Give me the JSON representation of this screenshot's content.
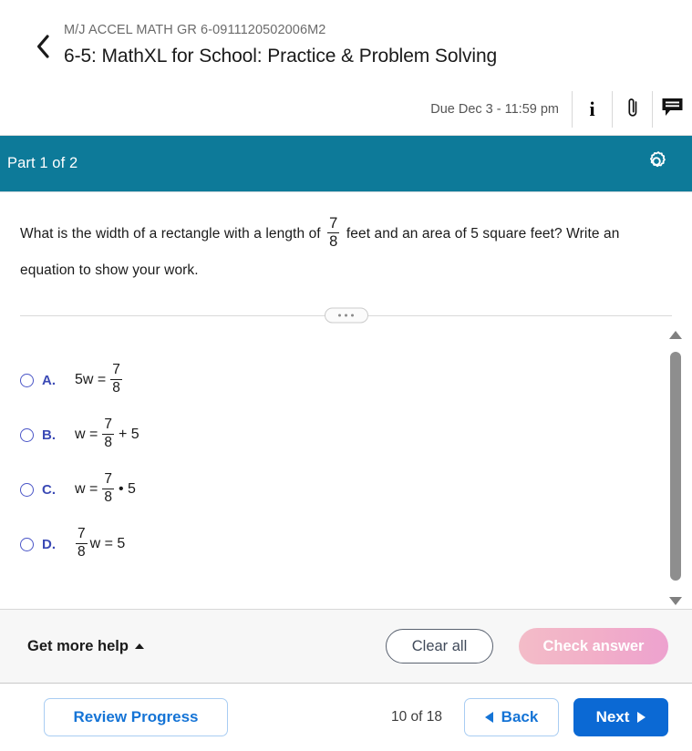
{
  "header": {
    "course_code": "M/J ACCEL MATH GR 6-0911120502006M2",
    "assignment_title": "6-5: MathXL for School: Practice & Problem Solving",
    "due_text": "Due Dec 3 - 11:59 pm",
    "back_icon": "chevron-left-icon",
    "icons": [
      {
        "name": "info-icon",
        "glyph": "i"
      },
      {
        "name": "paperclip-icon",
        "glyph": "paperclip"
      },
      {
        "name": "message-icon",
        "glyph": "speech-bubble"
      }
    ]
  },
  "part_bar": {
    "label": "Part 1 of 2",
    "settings_icon": "gear-icon",
    "background_color": "#0d7a99"
  },
  "question": {
    "text_before": "What is the width of a rectangle with a length of",
    "fraction": {
      "numerator": "7",
      "denominator": "8"
    },
    "text_after": "feet and an area of 5 square feet? Write an equation to show your work."
  },
  "divider": {
    "handle_icon": "drag-handle-dots-icon"
  },
  "options": [
    {
      "letter": "A.",
      "selected": false,
      "parts": [
        {
          "type": "text",
          "value": "5w ="
        },
        {
          "type": "fraction",
          "numerator": "7",
          "denominator": "8"
        }
      ],
      "plain": "5w = 7/8"
    },
    {
      "letter": "B.",
      "selected": false,
      "parts": [
        {
          "type": "text",
          "value": "w ="
        },
        {
          "type": "fraction",
          "numerator": "7",
          "denominator": "8"
        },
        {
          "type": "text",
          "value": "+ 5"
        }
      ],
      "plain": "w = 7/8 + 5"
    },
    {
      "letter": "C.",
      "selected": false,
      "parts": [
        {
          "type": "text",
          "value": "w ="
        },
        {
          "type": "fraction",
          "numerator": "7",
          "denominator": "8"
        },
        {
          "type": "text",
          "value": "• 5"
        }
      ],
      "plain": "w = 7/8 • 5"
    },
    {
      "letter": "D.",
      "selected": false,
      "parts": [
        {
          "type": "fraction",
          "numerator": "7",
          "denominator": "8"
        },
        {
          "type": "text",
          "value": "w = 5"
        }
      ],
      "plain": "7/8 w = 5"
    }
  ],
  "scrollbar": {
    "up_icon": "scroll-up-arrow-icon",
    "down_icon": "scroll-down-arrow-icon"
  },
  "action_bar": {
    "get_more_help_label": "Get more help",
    "get_more_help_caret": "caret-up-icon",
    "clear_all_label": "Clear all",
    "check_answer_label": "Check answer",
    "check_answer_disabled": true,
    "check_answer_color": "#f0b0c8"
  },
  "bottom_nav": {
    "review_progress_label": "Review Progress",
    "page_indicator": "10 of 18",
    "back_label": "Back",
    "next_label": "Next",
    "back_icon": "triangle-left-icon",
    "next_icon": "triangle-right-icon",
    "accent_color": "#0b69d4"
  }
}
